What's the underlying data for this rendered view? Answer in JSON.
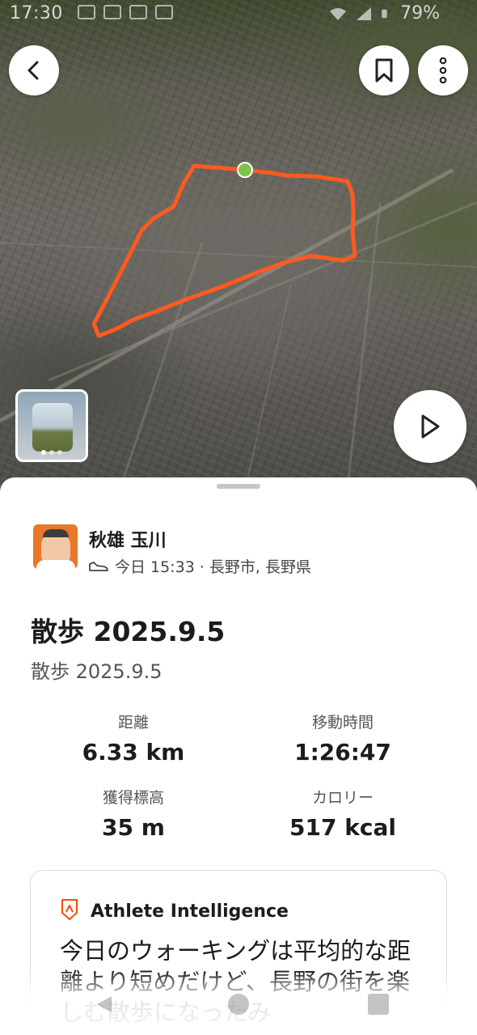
{
  "status_bar": {
    "time": "17:30",
    "battery": "79%"
  },
  "map": {
    "route_color": "#ff5a1f",
    "start_marker_color": "#7ec24a"
  },
  "buttons": {
    "back": "chevron-left-icon",
    "bookmark": "bookmark-icon",
    "more": "more-vertical-icon",
    "play": "play-icon"
  },
  "athlete": {
    "name": "秋雄 玉川",
    "meta": "今日 15:33 · 長野市, 長野県"
  },
  "activity": {
    "title": "散歩 2025.9.5",
    "description": "散歩 2025.9.5"
  },
  "stats": {
    "distance": {
      "label": "距離",
      "value": "6.33 km"
    },
    "moving_time": {
      "label": "移動時間",
      "value": "1:26:47"
    },
    "elevation_gain": {
      "label": "獲得標高",
      "value": "35 m"
    },
    "calories": {
      "label": "カロリー",
      "value": "517 kcal"
    }
  },
  "athlete_intelligence": {
    "title": "Athlete Intelligence",
    "text": "今日のウォーキングは平均的な距離より短めだけど、長野の街を楽しむ散歩になったみ"
  },
  "colors": {
    "accent": "#fc4c02"
  }
}
